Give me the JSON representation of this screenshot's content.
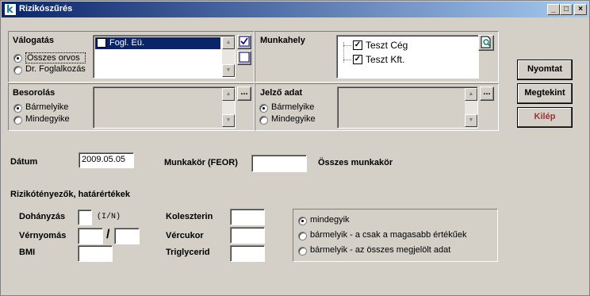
{
  "window": {
    "title": "Rizikószűrés",
    "min_label": "_",
    "max_label": "□",
    "close_label": "×"
  },
  "valogatas": {
    "title": "Válogatás",
    "options": [
      "Összes orvos",
      "Dr. Foglalkozás"
    ],
    "list": [
      {
        "label": "Fogl. Eü.",
        "checked": true
      }
    ]
  },
  "munkahely": {
    "title": "Munkahely",
    "list": [
      {
        "label": "Teszt Cég",
        "checked": true
      },
      {
        "label": "Teszt Kft.",
        "checked": true
      }
    ]
  },
  "besorolas": {
    "title": "Besorolás",
    "options": [
      "Bármelyike",
      "Mindegyike"
    ],
    "ellipsis": "..."
  },
  "jelzo": {
    "title": "Jelző adat",
    "options": [
      "Bármelyike",
      "Mindegyike"
    ],
    "ellipsis": "..."
  },
  "buttons": {
    "print": "Nyomtat",
    "view": "Megtekint",
    "exit": "Kilép"
  },
  "datum": {
    "label": "Dátum",
    "value": "2009.05.05"
  },
  "munkakor": {
    "label": "Munkakör (FEOR)",
    "value": "",
    "hint": "Összes munkakör"
  },
  "risk": {
    "title": "Rizikótényezők, határértékek",
    "dohanyzas": {
      "label": "Dohányzás",
      "hint": "(I/N)"
    },
    "vernyomas": {
      "label": "Vérnyomás",
      "separator": "/"
    },
    "bmi": {
      "label": "BMI"
    },
    "koleszterin": {
      "label": "Koleszterin"
    },
    "vercukor": {
      "label": "Vércukor"
    },
    "triglycerid": {
      "label": "Triglycerid"
    }
  },
  "filter_mode": {
    "options": [
      "mindegyik",
      "bármelyik - a csak a magasabb értékűek",
      "bármelyik - az összes megjelölt adat"
    ],
    "selected": 0
  },
  "colors": {
    "title_start": "#0a246a",
    "title_end": "#a6caf0",
    "exit_text": "#993333"
  }
}
